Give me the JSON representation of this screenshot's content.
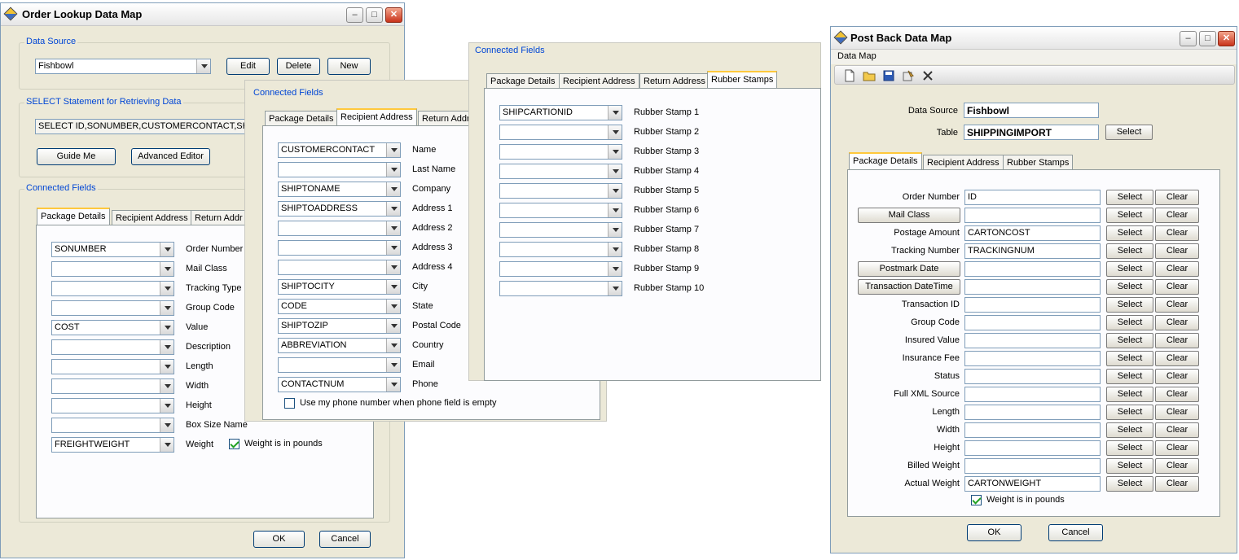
{
  "w1": {
    "title": "Order Lookup Data Map",
    "data_source_label": "Data Source",
    "data_source_value": "Fishbowl",
    "edit_label": "Edit",
    "delete_label": "Delete",
    "new_label": "New",
    "select_stmt_label": "SELECT Statement for Retrieving Data",
    "select_stmt_value": "SELECT ID,SONUMBER,CUSTOMERCONTACT,SH",
    "guide_me_label": "Guide Me",
    "advanced_editor_label": "Advanced Editor",
    "connected_fields_label": "Connected Fields",
    "tabs": [
      "Package Details",
      "Recipient Address",
      "Return Addr"
    ],
    "fields": [
      {
        "value": "SONUMBER",
        "label": "Order Number"
      },
      {
        "value": "",
        "label": "Mail Class"
      },
      {
        "value": "",
        "label": "Tracking Type"
      },
      {
        "value": "",
        "label": "Group Code"
      },
      {
        "value": "COST",
        "label": "Value"
      },
      {
        "value": "",
        "label": "Description"
      },
      {
        "value": "",
        "label": "Length"
      },
      {
        "value": "",
        "label": "Width"
      },
      {
        "value": "",
        "label": "Height"
      },
      {
        "value": "",
        "label": "Box Size Name"
      },
      {
        "value": "FREIGHTWEIGHT",
        "label": "Weight"
      }
    ],
    "weight_pounds_label": "Weight is in pounds",
    "weight_pounds_checked": true,
    "ok_label": "OK",
    "cancel_label": "Cancel"
  },
  "w2": {
    "connected_fields_label": "Connected Fields",
    "tabs": [
      "Package Details",
      "Recipient Address",
      "Return Addr"
    ],
    "fields": [
      {
        "value": "CUSTOMERCONTACT",
        "label": "Name"
      },
      {
        "value": "",
        "label": "Last Name"
      },
      {
        "value": "SHIPTONAME",
        "label": "Company"
      },
      {
        "value": "SHIPTOADDRESS",
        "label": "Address 1"
      },
      {
        "value": "",
        "label": "Address 2"
      },
      {
        "value": "",
        "label": "Address 3"
      },
      {
        "value": "",
        "label": "Address 4"
      },
      {
        "value": "SHIPTOCITY",
        "label": "City"
      },
      {
        "value": "CODE",
        "label": "State"
      },
      {
        "value": "SHIPTOZIP",
        "label": "Postal Code"
      },
      {
        "value": "ABBREVIATION",
        "label": "Country"
      },
      {
        "value": "",
        "label": "Email"
      },
      {
        "value": "CONTACTNUM",
        "label": "Phone"
      }
    ],
    "phone_checkbox_label": "Use my phone number when phone field is empty",
    "phone_checkbox_checked": false
  },
  "w3": {
    "connected_fields_label": "Connected Fields",
    "tabs": [
      "Package Details",
      "Recipient Address",
      "Return Address",
      "Rubber Stamps"
    ],
    "fields": [
      {
        "value": "SHIPCARTIONID",
        "label": "Rubber Stamp 1"
      },
      {
        "value": "",
        "label": "Rubber Stamp 2"
      },
      {
        "value": "",
        "label": "Rubber Stamp 3"
      },
      {
        "value": "",
        "label": "Rubber Stamp 4"
      },
      {
        "value": "",
        "label": "Rubber Stamp 5"
      },
      {
        "value": "",
        "label": "Rubber Stamp 6"
      },
      {
        "value": "",
        "label": "Rubber Stamp 7"
      },
      {
        "value": "",
        "label": "Rubber Stamp 8"
      },
      {
        "value": "",
        "label": "Rubber Stamp 9"
      },
      {
        "value": "",
        "label": "Rubber Stamp 10"
      }
    ]
  },
  "w4": {
    "title": "Post Back Data Map",
    "menu_label": "Data Map",
    "toolbar_icons": [
      "new-file-icon",
      "open-folder-icon",
      "save-icon",
      "properties-icon",
      "delete-x-icon"
    ],
    "data_source_label": "Data Source",
    "data_source_value": "Fishbowl",
    "table_label": "Table",
    "table_value": "SHIPPINGIMPORT",
    "table_select_label": "Select",
    "tabs": [
      "Package Details",
      "Recipient Address",
      "Rubber Stamps"
    ],
    "select_label": "Select",
    "clear_label": "Clear",
    "rows": [
      {
        "label": "Order Number",
        "value": "ID",
        "button": false
      },
      {
        "label": "Mail Class",
        "value": "",
        "button": true
      },
      {
        "label": "Postage Amount",
        "value": "CARTONCOST",
        "button": false
      },
      {
        "label": "Tracking Number",
        "value": "TRACKINGNUM",
        "button": false
      },
      {
        "label": "Postmark Date",
        "value": "",
        "button": true
      },
      {
        "label": "Transaction DateTime",
        "value": "",
        "button": true
      },
      {
        "label": "Transaction ID",
        "value": "",
        "button": false
      },
      {
        "label": "Group Code",
        "value": "",
        "button": false
      },
      {
        "label": "Insured Value",
        "value": "",
        "button": false
      },
      {
        "label": "Insurance Fee",
        "value": "",
        "button": false
      },
      {
        "label": "Status",
        "value": "",
        "button": false
      },
      {
        "label": "Full XML Source",
        "value": "",
        "button": false
      },
      {
        "label": "Length",
        "value": "",
        "button": false
      },
      {
        "label": "Width",
        "value": "",
        "button": false
      },
      {
        "label": "Height",
        "value": "",
        "button": false
      },
      {
        "label": "Billed Weight",
        "value": "",
        "button": false
      },
      {
        "label": "Actual Weight",
        "value": "CARTONWEIGHT",
        "button": false
      }
    ],
    "weight_pounds_label": "Weight is in pounds",
    "weight_pounds_checked": true,
    "ok_label": "OK",
    "cancel_label": "Cancel"
  }
}
